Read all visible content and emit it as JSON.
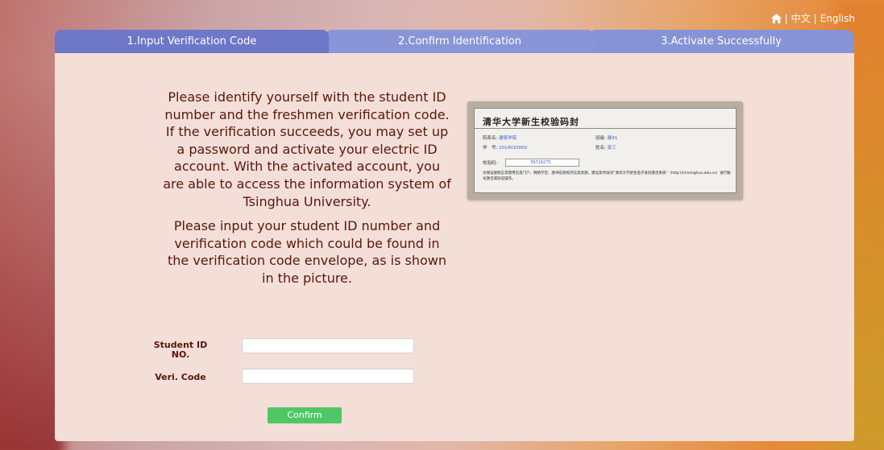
{
  "header": {
    "home_icon": "home-icon",
    "separator": "|",
    "lang_chinese": "中文",
    "lang_english": "English"
  },
  "tabs": [
    {
      "label": "1.Input Verification Code",
      "active": true
    },
    {
      "label": "2.Confirm Identification",
      "active": false
    },
    {
      "label": "3.Activate Successfully",
      "active": false
    }
  ],
  "main": {
    "intro": "Please identify yourself with the student ID number and the freshmen verification code. If the verification succeeds, you may set up a password and activate your electric ID account. With the activated account, you are able to access the information system of Tsinghua University.",
    "instruction": "Please input your student ID number and verification code which could be found in the verification code envelope, as is shown in the picture."
  },
  "envelope": {
    "title": "清华大学新生校验码封",
    "dept_label": "院系名:",
    "dept_value": "建筑学院",
    "class_label": "班级:",
    "class_value": "建41",
    "id_label": "学　号:",
    "id_value": "2014010000",
    "name_label": "姓名:",
    "name_value": "张三",
    "code_label": "校验码:",
    "code_value": "3971627S",
    "note": "为保证能够正常使用信息门户、网络学堂、图书馆等校内信息资源，建议及时访问“清华大学新生电子身份激活系统”（http://id.tsinghua.edu.cn）进行账号激活或验证操作。"
  },
  "form": {
    "student_id_label": "Student ID NO.",
    "student_id_value": "",
    "veri_code_label": "Veri. Code",
    "veri_code_value": "",
    "confirm_label": "Confirm"
  },
  "colors": {
    "active_tab": "#6e77c8",
    "inactive_tab": "#8995d6",
    "panel_bg": "#f3dfd8",
    "text": "#5a1608",
    "confirm_button": "#4fc764"
  }
}
